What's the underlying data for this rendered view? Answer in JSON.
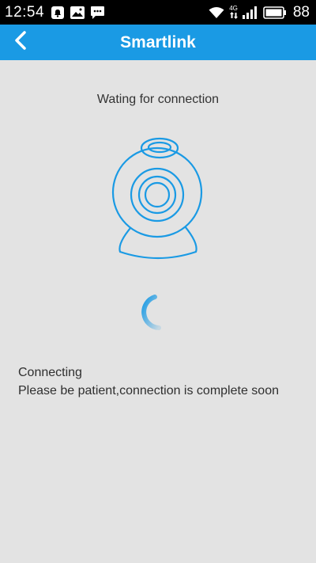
{
  "status_bar": {
    "time": "12:54",
    "network_type": "4G",
    "battery_level": "88",
    "icons": [
      "notification-bell-icon",
      "gallery-icon",
      "message-icon",
      "wifi-icon",
      "signal-icon",
      "battery-icon"
    ]
  },
  "app_bar": {
    "title": "Smartlink",
    "back_icon": "chevron-left-icon"
  },
  "main": {
    "waiting_label": "Wating for connection",
    "illustration": "webcam-icon",
    "status_title": "Connecting",
    "status_message": "Please be patient,connection is complete soon"
  },
  "colors": {
    "accent": "#1a9ae4",
    "background": "#e3e3e3",
    "status_bar": "#000000",
    "text": "#333333"
  }
}
